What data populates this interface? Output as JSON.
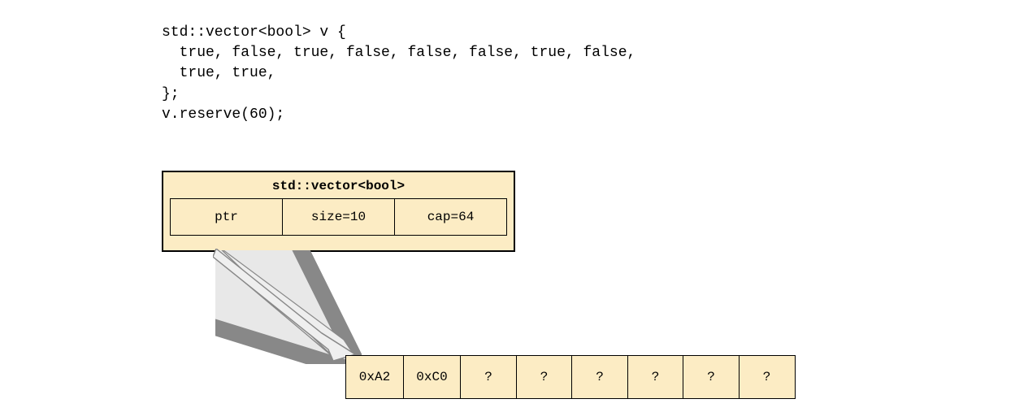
{
  "code": {
    "line1": "std::vector<bool> v {",
    "line2": "  true, false, true, false, false, false, true, false,",
    "line3": "  true, true,",
    "line4": "};",
    "line5": "v.reserve(60);"
  },
  "vector": {
    "title": "std::vector<bool>",
    "fields": {
      "ptr": "ptr",
      "size": "size=10",
      "cap": "cap=64"
    }
  },
  "memory": {
    "cells": [
      "0xA2",
      "0xC0",
      "?",
      "?",
      "?",
      "?",
      "?",
      "?"
    ]
  }
}
